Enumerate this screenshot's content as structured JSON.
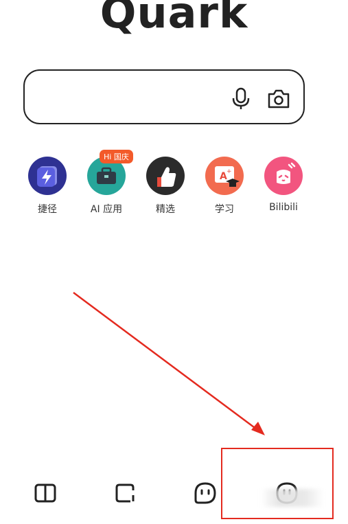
{
  "logo": {
    "text": "Quark"
  },
  "search": {
    "mic_icon": "microphone-icon",
    "camera_icon": "camera-icon"
  },
  "shortcuts": [
    {
      "label": "捷径",
      "icon": "lightning-icon",
      "color": "#3b3f9e"
    },
    {
      "label": "AI 应用",
      "icon": "briefcase-icon",
      "color": "#2a9d8f",
      "badge": "Hi 国庆"
    },
    {
      "label": "精选",
      "icon": "thumbs-up-icon",
      "color": "#2b2b2b"
    },
    {
      "label": "学习",
      "icon": "graduation-icon",
      "color": "#f06a4a"
    },
    {
      "label": "Bilibili",
      "icon": "bilibili-icon",
      "color": "#f25d8e"
    }
  ],
  "bottom_tabs": [
    {
      "name": "book-icon"
    },
    {
      "name": "tabs-icon"
    },
    {
      "name": "smile-chat-icon"
    },
    {
      "name": "profile-icon"
    }
  ],
  "annotation": {
    "arrow_color": "#e42a1f",
    "box_color": "#e42a1f"
  }
}
